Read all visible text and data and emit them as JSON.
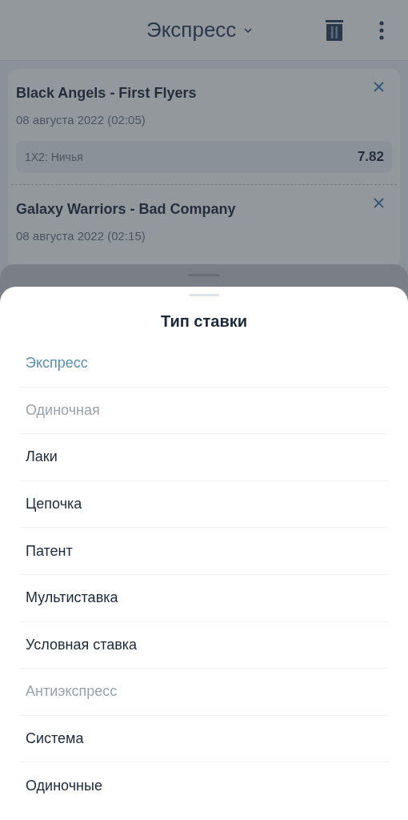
{
  "header": {
    "title": "Экспресс"
  },
  "bets": [
    {
      "match": "Black Angels - First Flyers",
      "date": "08 августа 2022 (02:05)",
      "outcome": "1X2: Ничья",
      "odds": "7.82"
    },
    {
      "match": "Galaxy Warriors - Bad Company",
      "date": "08 августа 2022 (02:15)"
    }
  ],
  "sheet": {
    "title": "Тип ставки",
    "options": [
      {
        "label": "Экспресс",
        "selected": true,
        "disabled": false
      },
      {
        "label": "Одиночная",
        "selected": false,
        "disabled": true
      },
      {
        "label": "Лаки",
        "selected": false,
        "disabled": false
      },
      {
        "label": "Цепочка",
        "selected": false,
        "disabled": false
      },
      {
        "label": "Патент",
        "selected": false,
        "disabled": false
      },
      {
        "label": "Мультиставка",
        "selected": false,
        "disabled": false
      },
      {
        "label": "Условная ставка",
        "selected": false,
        "disabled": false
      },
      {
        "label": "Антиэкспресс",
        "selected": false,
        "disabled": true
      },
      {
        "label": "Система",
        "selected": false,
        "disabled": false
      },
      {
        "label": "Одиночные",
        "selected": false,
        "disabled": false
      }
    ]
  }
}
